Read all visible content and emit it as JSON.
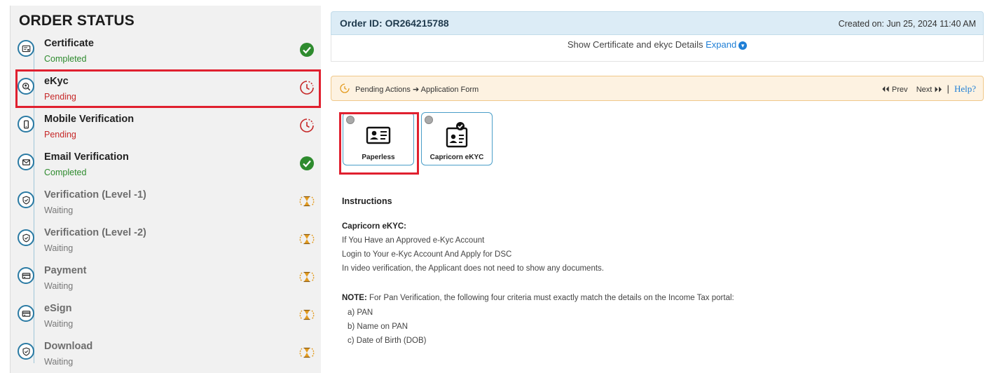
{
  "order_status": {
    "title": "ORDER STATUS",
    "steps": [
      {
        "title": "Certificate",
        "status": "Completed",
        "state": "completed",
        "icon": "certificate-icon"
      },
      {
        "title": "eKyc",
        "status": "Pending",
        "state": "pending",
        "icon": "search-user-icon"
      },
      {
        "title": "Mobile Verification",
        "status": "Pending",
        "state": "pending",
        "icon": "mobile-icon"
      },
      {
        "title": "Email Verification",
        "status": "Completed",
        "state": "completed",
        "icon": "mail-icon"
      },
      {
        "title": "Verification (Level -1)",
        "status": "Waiting",
        "state": "waiting",
        "icon": "shield-icon"
      },
      {
        "title": "Verification (Level -2)",
        "status": "Waiting",
        "state": "waiting",
        "icon": "shield-icon"
      },
      {
        "title": "Payment",
        "status": "Waiting",
        "state": "waiting",
        "icon": "card-icon"
      },
      {
        "title": "eSign",
        "status": "Waiting",
        "state": "waiting",
        "icon": "card-icon"
      },
      {
        "title": "Download",
        "status": "Waiting",
        "state": "waiting",
        "icon": "shield-icon"
      }
    ]
  },
  "order": {
    "id_label": "Order ID: OR264215788",
    "created": "Created on: Jun 25, 2024 11:40 AM",
    "details_text": "Show Certificate and ekyc Details",
    "expand_label": "Expand"
  },
  "pending_actions": {
    "breadcrumb_start": "Pending Actions",
    "breadcrumb_end": "Application Form",
    "prev_label": "Prev",
    "next_label": "Next",
    "help_label": "Help"
  },
  "kyc_options": [
    {
      "label": "Paperless",
      "icon": "id-card-icon"
    },
    {
      "label": "Capricorn eKYC",
      "icon": "verified-id-icon"
    }
  ],
  "instructions": {
    "heading": "Instructions",
    "sub_heading": "Capricorn eKYC:",
    "lines": [
      "If You Have an Approved e-Kyc Account",
      "Login to Your e-Kyc Account And Apply for DSC",
      "In video verification, the Applicant does not need to show any documents."
    ],
    "note_label": "NOTE:",
    "note_text": "For Pan Verification, the following four criteria must exactly match the details on the Income Tax portal:",
    "criteria": [
      "a) PAN",
      "b) Name on PAN",
      "c) Date of Birth (DOB)"
    ]
  },
  "colors": {
    "completed": "#2e8b2e",
    "pending": "#c62828",
    "waiting": "#e39b1f",
    "accent": "#1f7fd6",
    "highlight": "#e0202f"
  }
}
